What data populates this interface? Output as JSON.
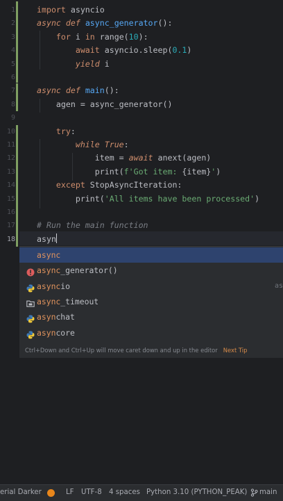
{
  "editor": {
    "line_numbers": [
      "1",
      "2",
      "3",
      "4",
      "5",
      "6",
      "7",
      "8",
      "9",
      "10",
      "11",
      "12",
      "13",
      "14",
      "15",
      "16",
      "17",
      "18"
    ],
    "active_line": "18",
    "lines": {
      "l1": [
        {
          "t": "import",
          "c": "kw"
        },
        {
          "t": " asyncio",
          "c": ""
        }
      ],
      "l2": [
        {
          "t": "async def",
          "c": "kwi"
        },
        {
          "t": " ",
          "c": ""
        },
        {
          "t": "async_generator",
          "c": "fn"
        },
        {
          "t": "():",
          "c": ""
        }
      ],
      "l3": [
        {
          "t": "    ",
          "c": ""
        },
        {
          "t": "for",
          "c": "kw"
        },
        {
          "t": " i ",
          "c": ""
        },
        {
          "t": "in",
          "c": "kw"
        },
        {
          "t": " range(",
          "c": ""
        },
        {
          "t": "10",
          "c": "num"
        },
        {
          "t": "):",
          "c": ""
        }
      ],
      "l4": [
        {
          "t": "        ",
          "c": ""
        },
        {
          "t": "await",
          "c": "kw"
        },
        {
          "t": " asyncio.sleep(",
          "c": ""
        },
        {
          "t": "0.1",
          "c": "num"
        },
        {
          "t": ")",
          "c": ""
        }
      ],
      "l5": [
        {
          "t": "        ",
          "c": ""
        },
        {
          "t": "yield",
          "c": "kwi"
        },
        {
          "t": " i",
          "c": ""
        }
      ],
      "l7": [
        {
          "t": "async def",
          "c": "kwi"
        },
        {
          "t": " ",
          "c": ""
        },
        {
          "t": "main",
          "c": "fn"
        },
        {
          "t": "():",
          "c": ""
        }
      ],
      "l8": [
        {
          "t": "    agen = async_generator()",
          "c": ""
        }
      ],
      "l10": [
        {
          "t": "    ",
          "c": ""
        },
        {
          "t": "try",
          "c": "kw"
        },
        {
          "t": ":",
          "c": ""
        }
      ],
      "l11": [
        {
          "t": "        ",
          "c": ""
        },
        {
          "t": "while",
          "c": "kwi"
        },
        {
          "t": " ",
          "c": ""
        },
        {
          "t": "True",
          "c": "kwi"
        },
        {
          "t": ":",
          "c": ""
        }
      ],
      "l12": [
        {
          "t": "            item = ",
          "c": ""
        },
        {
          "t": "await",
          "c": "kwi"
        },
        {
          "t": " anext(agen)",
          "c": ""
        }
      ],
      "l13": [
        {
          "t": "            print(",
          "c": ""
        },
        {
          "t": "f'Got item: ",
          "c": "str"
        },
        {
          "t": "{item}",
          "c": ""
        },
        {
          "t": "'",
          "c": "str"
        },
        {
          "t": ")",
          "c": ""
        }
      ],
      "l14": [
        {
          "t": "    ",
          "c": ""
        },
        {
          "t": "except",
          "c": "kw"
        },
        {
          "t": " StopAsyncIteration:",
          "c": ""
        }
      ],
      "l15": [
        {
          "t": "        print(",
          "c": ""
        },
        {
          "t": "'All items have been processed'",
          "c": "str"
        },
        {
          "t": ")",
          "c": ""
        }
      ],
      "l17": [
        {
          "t": "# Run the main function",
          "c": "cm"
        }
      ],
      "l18": [
        {
          "t": "asyn",
          "c": ""
        }
      ]
    }
  },
  "completion": {
    "items": [
      {
        "hl": "async",
        "rest": "",
        "icon": "none-icon",
        "selected": true
      },
      {
        "hl": "async",
        "rest": "_generator()",
        "icon": "function-error-icon",
        "selected": false
      },
      {
        "hl": "async",
        "rest": "io",
        "icon": "python-module-icon",
        "selected": false,
        "side": "as"
      },
      {
        "hl": "async",
        "rest": "_timeout",
        "icon": "folder-package-icon",
        "selected": false
      },
      {
        "hl": "async",
        "rest": "hat",
        "icon": "python-module-icon",
        "selected": false,
        "display_hl": "asyn",
        "display_rest": "chat"
      },
      {
        "hl": "async",
        "rest": "ore",
        "icon": "python-module-icon",
        "selected": false,
        "display_hl": "asyn",
        "display_rest": "core"
      }
    ],
    "tip_text": "Ctrl+Down and Ctrl+Up will move caret down and up in the editor",
    "tip_link": "Next Tip"
  },
  "status_bar": {
    "theme": "erial Darker",
    "line_sep": "LF",
    "encoding": "UTF-8",
    "indent": "4 spaces",
    "interpreter": "Python 3.10 (PYTHON_PEAK)",
    "branch": "main",
    "colors": {
      "warning_dot": "#e8861b"
    }
  }
}
